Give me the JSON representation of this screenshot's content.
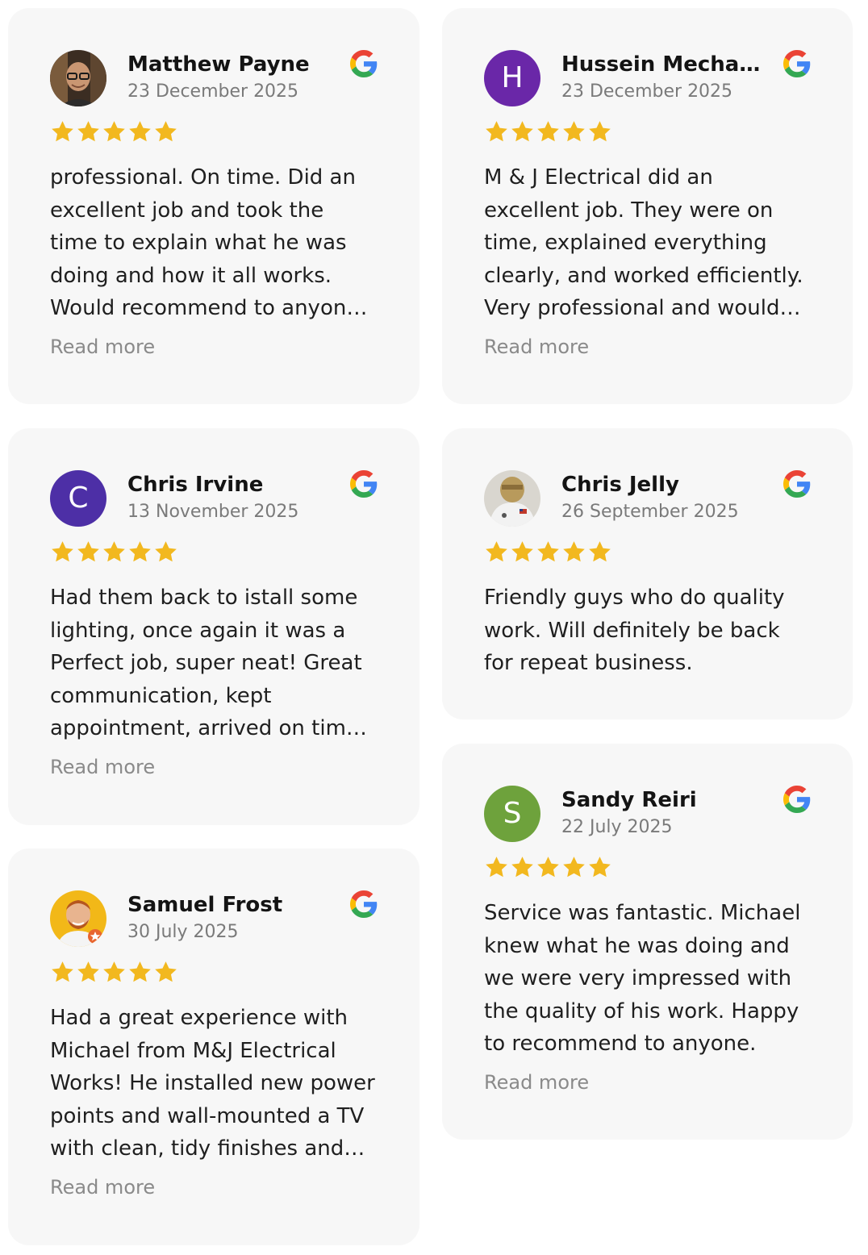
{
  "colors": {
    "card_background": "#f7f7f7",
    "star": "#f2b81f",
    "name": "#141414",
    "date": "#7a7a7a",
    "read_more": "#8a8a8a",
    "google_blue": "#4285F4",
    "google_red": "#EA4335",
    "google_yellow": "#FBBC05",
    "google_green": "#34A853"
  },
  "read_more_label": "Read more",
  "reviews": [
    {
      "name": "Matthew Payne",
      "date": "23 December 2025",
      "rating": 5,
      "avatar": {
        "type": "photo",
        "initial": "",
        "color": "#6b5a4a"
      },
      "text": "professional. On time. Did an excellent job and took the time to explain what he was doing and how it all works. Would recommend to anyone needing electrical work done.",
      "has_read_more": true
    },
    {
      "name": "Hussein Mechaouri",
      "date": "23 December 2025",
      "rating": 5,
      "avatar": {
        "type": "initial",
        "initial": "H",
        "color": "#6a27a8"
      },
      "text": "M & J Electrical did an excellent job. They were on time, explained everything clearly, and worked efficiently. Very professional and would definitely use them again.",
      "has_read_more": true
    },
    {
      "name": "Chris Irvine",
      "date": "13 November 2025",
      "rating": 5,
      "avatar": {
        "type": "initial",
        "initial": "C",
        "color": "#4d2fa6"
      },
      "text": "Had them back to istall some lighting, once again it was a Perfect job, super neat! Great communication, kept appointment, arrived on time and cleaned up afterwards.",
      "has_read_more": true
    },
    {
      "name": "Chris Jelly",
      "date": "26 September 2025",
      "rating": 5,
      "avatar": {
        "type": "photo",
        "initial": "",
        "color": "#d9d6cf"
      },
      "text": "Friendly guys who do quality work. Will definitely be back for repeat business.",
      "has_read_more": false
    },
    {
      "name": "Samuel Frost",
      "date": "30 July 2025",
      "rating": 5,
      "avatar": {
        "type": "photo",
        "initial": "",
        "color": "#f2b818"
      },
      "text": "Had a great experience with Michael from M&J Electrical Works! He installed new power points and wall-mounted a TV with clean, tidy finishes and great attention to detail.",
      "has_read_more": true
    },
    {
      "name": "Sandy Reiri",
      "date": "22 July 2025",
      "rating": 5,
      "avatar": {
        "type": "initial",
        "initial": "S",
        "color": "#6ea23c"
      },
      "text": "Service was fantastic. Michael knew what he was doing and we were very impressed with the quality of his work. Happy to recommend to anyone.",
      "has_read_more": true
    }
  ]
}
